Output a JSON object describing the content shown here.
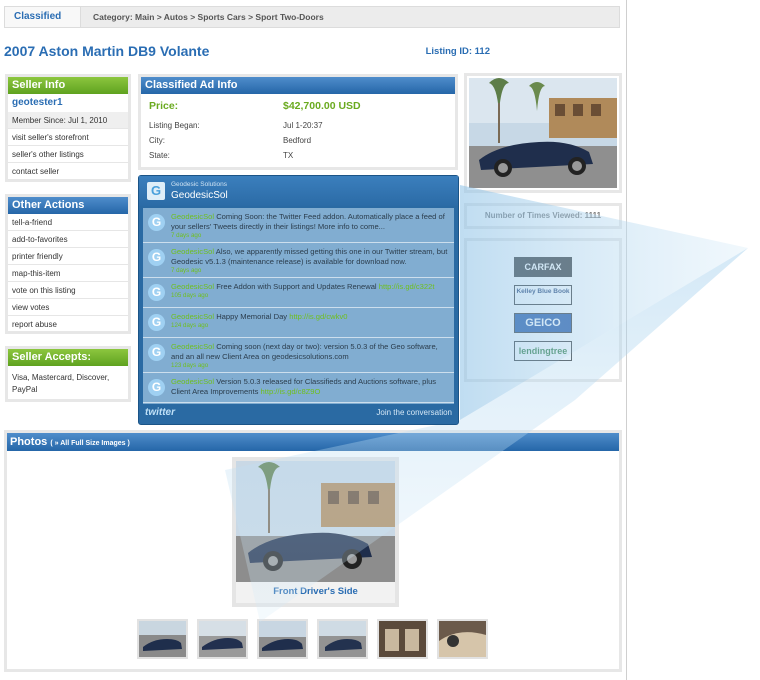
{
  "breadcrumb": {
    "home": "Classified",
    "path": "Category: Main > Autos > Sports Cars > Sport Two-Doors"
  },
  "listing": {
    "title": "2007 Aston Martin DB9 Volante",
    "id_label": "Listing ID: 112"
  },
  "seller_info": {
    "header": "Seller Info",
    "name": "geotester1",
    "member_since": "Member Since: Jul 1, 2010",
    "links": [
      "visit seller's storefront",
      "seller's other listings",
      "contact seller"
    ]
  },
  "other_actions": {
    "header": "Other Actions",
    "items": [
      "tell-a-friend",
      "add-to-favorites",
      "printer friendly",
      "map-this-item",
      "vote on this listing",
      "view votes",
      "report abuse"
    ]
  },
  "seller_accepts": {
    "header": "Seller Accepts:",
    "text": "Visa, Mastercard, Discover, PayPal"
  },
  "ad_info": {
    "header": "Classified Ad Info",
    "price_label": "Price:",
    "price_value": "$42,700.00 USD",
    "rows": [
      {
        "k": "Listing Began:",
        "v": "Jul 1-20:37"
      },
      {
        "k": "City:",
        "v": "Bedford"
      },
      {
        "k": "State:",
        "v": "TX"
      }
    ]
  },
  "views": "Number of Times Viewed: 1111",
  "sponsors": [
    "CARFAX",
    "Kelley Blue Book",
    "GEICO",
    "lendingtree"
  ],
  "twitter": {
    "account_small": "Geodesic Solutions",
    "account": "GeodesicSol",
    "tweets": [
      {
        "who": "GeodesicSol",
        "text": "Coming Soon: the Twitter Feed addon. Automatically place a feed of your sellers' Tweets directly in their listings! More info to come...",
        "link": "",
        "age": "7 days ago"
      },
      {
        "who": "GeodesicSol",
        "text": "Also, we apparently missed getting this one in our Twitter stream, but Geodesic v5.1.3 (maintenance release) is available for download now.",
        "link": "",
        "age": "7 days ago"
      },
      {
        "who": "GeodesicSol",
        "text": "Free Addon with Support and Updates Renewal",
        "link": "http://is.gd/c322t",
        "age": "105 days ago"
      },
      {
        "who": "GeodesicSol",
        "text": "Happy Memorial Day",
        "link": "http://is.gd/cwkv0",
        "age": "124 days ago"
      },
      {
        "who": "GeodesicSol",
        "text": "Coming soon (next day or two): version 5.0.3 of the Geo software, and an all new Client Area on geodesicsolutions.com",
        "link": "",
        "age": "123 days ago"
      },
      {
        "who": "GeodesicSol",
        "text": "Version 5.0.3 released for Classifieds and Auctions software, plus Client Area Improvements",
        "link": "http://is.gd/c8Z9O",
        "age": ""
      }
    ],
    "logo": "twitter",
    "join": "Join the conversation"
  },
  "photos": {
    "header": "Photos",
    "header_link": "( » All Full Size Images )",
    "caption": "Front Driver's Side",
    "thumb_count_names": [
      "thumb-1",
      "thumb-2",
      "thumb-3",
      "thumb-4",
      "thumb-5",
      "thumb-6"
    ]
  }
}
